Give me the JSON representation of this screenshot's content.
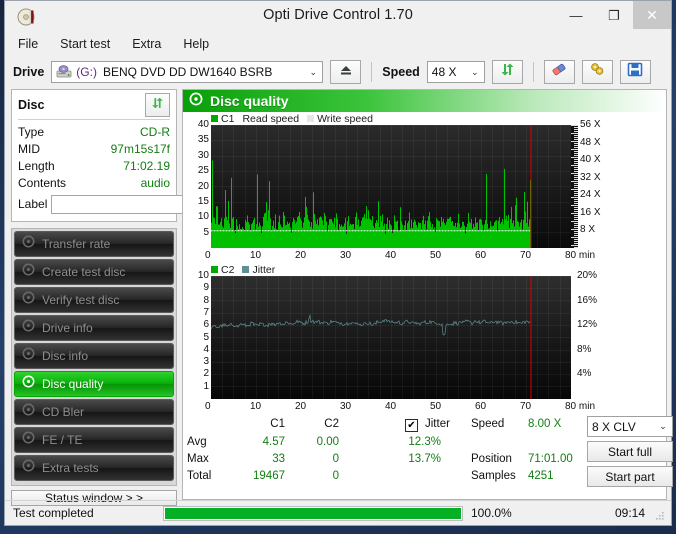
{
  "window": {
    "title": "Opti Drive Control 1.70",
    "icon": "disc-icon",
    "minimize": "—",
    "maximize": "❐",
    "close": "✕"
  },
  "menu": {
    "items": [
      "File",
      "Start test",
      "Extra",
      "Help"
    ]
  },
  "toolbar": {
    "drive_label": "Drive",
    "drive_letter": "(G:)",
    "drive_value": "BENQ DVD DD DW1640 BSRB",
    "speed_label": "Speed",
    "speed_value": "48 X",
    "refresh_icon": "refresh-arrows-icon",
    "eject_icon": "eject-icon",
    "erase_icon": "eraser-icon",
    "bitsetting_icon": "bitsetting-icon",
    "save_icon": "floppy-save-icon",
    "caret": "⌄"
  },
  "disc": {
    "header": "Disc",
    "refresh_icon": "refresh-arrows-icon",
    "rows": [
      {
        "key": "Type",
        "value": "CD-R"
      },
      {
        "key": "MID",
        "value": "97m15s17f"
      },
      {
        "key": "Length",
        "value": "71:02.19"
      },
      {
        "key": "Contents",
        "value": "audio"
      }
    ],
    "label_key": "Label",
    "label_value": "",
    "label_placeholder": "",
    "cd_icon": "cd-disc-icon"
  },
  "nav": {
    "items": [
      {
        "label": "Transfer rate",
        "icon": "disc-icon",
        "active": false
      },
      {
        "label": "Create test disc",
        "icon": "disc-icon",
        "active": false
      },
      {
        "label": "Verify test disc",
        "icon": "disc-icon",
        "active": false
      },
      {
        "label": "Drive info",
        "icon": "disc-icon",
        "active": false
      },
      {
        "label": "Disc info",
        "icon": "disc-icon",
        "active": false
      },
      {
        "label": "Disc quality",
        "icon": "disc-icon",
        "active": true
      },
      {
        "label": "CD Bler",
        "icon": "disc-icon",
        "active": false
      },
      {
        "label": "FE / TE",
        "icon": "disc-icon",
        "active": false
      },
      {
        "label": "Extra tests",
        "icon": "disc-icon",
        "active": false
      }
    ],
    "status_button": "Status window > >"
  },
  "panel": {
    "title": "Disc quality",
    "icon": "disc-icon"
  },
  "stats": {
    "col_c1": "C1",
    "col_c2": "C2",
    "rows": [
      {
        "label": "Avg",
        "c1": "4.57",
        "c2": "0.00",
        "jitter": "12.3%"
      },
      {
        "label": "Max",
        "c1": "33",
        "c2": "0",
        "jitter": "13.7%"
      },
      {
        "label": "Total",
        "c1": "19467",
        "c2": "0",
        "jitter": ""
      }
    ],
    "jitter_label": "Jitter",
    "jitter_checked": "✔",
    "speed_label": "Speed",
    "speed_value": "8.00 X",
    "position_label": "Position",
    "position_value": "71:01.00",
    "samples_label": "Samples",
    "samples_value": "4251",
    "write_strategy": "8 X CLV",
    "caret": "⌄",
    "start_full": "Start full",
    "start_part": "Start part"
  },
  "statusbar": {
    "message": "Test completed",
    "percent_text": "100.0%",
    "percent_value": 100,
    "time": "09:14",
    "grip_icon": "resize-grip-icon"
  },
  "colors": {
    "accent_green": "#00c000",
    "value_green": "#127d12",
    "jitter_teal": "#5f8f93",
    "plot_bg": "#121212",
    "marker_red": "#e00000",
    "avg_white": "#ffffff"
  },
  "chart_data": [
    {
      "type": "area",
      "name": "c1-chart",
      "title": "C1",
      "legend": [
        "C1",
        "Read speed",
        "Write speed"
      ],
      "legend_colors": [
        "#00a800",
        "#d8d8d8",
        "#e8e8e8"
      ],
      "xlabel": "min",
      "xlim": [
        0,
        80
      ],
      "xticks": [
        0,
        10,
        20,
        30,
        40,
        50,
        60,
        70,
        80
      ],
      "xtick_labels": [
        "0",
        "10",
        "20",
        "30",
        "40",
        "50",
        "60",
        "70",
        "80 min"
      ],
      "ylabel_left": "C1",
      "ylim": [
        0,
        40
      ],
      "yticks": [
        5,
        10,
        15,
        20,
        25,
        30,
        35,
        40
      ],
      "ylabel_right": "Speed",
      "ylim_right": [
        0,
        56
      ],
      "yticks_right": [
        8,
        16,
        24,
        32,
        40,
        48,
        56
      ],
      "ytick_labels_right": [
        "8 X",
        "16 X",
        "24 X",
        "32 X",
        "40 X",
        "48 X",
        "56 X"
      ],
      "data_end_min": 71.0,
      "marker_min": 71.0,
      "avg_line": 4.57,
      "avg_line_color": "#ffffff",
      "series": [
        {
          "name": "C1",
          "color": "#00c000",
          "x_start": 0,
          "x_end": 71.0,
          "values": [
            8,
            17,
            11,
            9,
            6,
            20,
            21,
            10,
            6,
            7,
            12,
            8,
            7,
            9,
            29,
            15,
            12,
            22,
            9,
            8,
            33,
            13,
            10,
            7,
            6,
            12,
            9,
            6,
            5,
            9,
            8,
            10,
            7,
            6,
            11,
            7,
            12,
            9,
            8,
            6,
            5,
            9,
            10,
            11,
            6,
            7,
            14,
            9,
            8,
            7,
            6,
            10,
            13,
            16,
            17,
            22,
            14,
            15,
            11,
            9,
            8,
            7,
            9,
            6,
            11,
            8,
            7,
            10,
            12,
            9,
            8,
            6,
            14,
            11,
            9,
            8,
            7,
            12,
            10,
            9,
            6,
            8,
            13,
            11,
            10,
            7,
            9,
            15,
            12,
            10,
            8,
            6,
            9,
            11,
            27,
            22,
            14,
            12,
            9,
            8,
            10,
            7,
            24,
            15,
            12,
            9,
            8,
            11,
            13,
            10,
            9,
            7,
            8,
            12,
            11,
            9,
            7,
            6,
            10,
            9,
            8,
            7,
            11,
            9,
            8,
            12,
            10,
            7,
            6,
            9,
            11,
            8,
            7,
            10,
            9,
            6,
            8,
            12,
            10,
            9,
            7,
            11,
            8,
            6,
            9,
            13,
            10,
            8,
            7,
            6,
            9,
            12,
            11,
            16,
            14,
            19,
            15,
            13,
            11,
            9,
            8,
            12,
            10,
            7,
            9,
            11,
            8,
            6,
            7,
            10,
            9,
            12,
            8,
            7,
            6,
            9,
            11,
            8,
            10,
            7,
            9,
            6,
            8,
            11,
            10,
            13,
            9,
            8,
            7,
            16,
            12,
            10,
            8,
            9,
            11,
            7,
            6,
            10,
            13,
            9,
            8,
            7,
            11,
            12,
            10,
            8,
            6,
            9,
            7,
            10,
            8,
            12,
            11,
            9,
            7,
            6,
            8,
            10,
            12,
            9,
            8,
            11,
            7,
            9,
            6,
            10,
            8,
            7,
            12,
            9,
            11,
            8,
            10,
            7,
            6,
            9,
            12,
            8,
            10,
            13,
            9,
            7,
            11,
            8,
            10,
            6,
            9,
            12,
            8,
            7,
            10,
            11,
            9,
            8,
            6,
            7,
            10,
            12,
            9,
            8,
            11,
            7,
            6,
            9,
            10,
            8,
            12,
            7,
            9,
            11,
            8,
            10,
            6,
            7,
            9,
            12,
            10,
            8,
            7,
            11,
            9,
            6,
            8,
            10,
            12,
            9,
            7,
            8,
            11,
            10,
            6,
            9,
            7,
            12,
            8,
            10,
            9,
            11,
            7
          ]
        }
      ]
    },
    {
      "type": "line",
      "name": "c2-jitter-chart",
      "title": "C2 / Jitter",
      "legend": [
        "C2",
        "Jitter"
      ],
      "legend_colors": [
        "#00a800",
        "#5f8f93"
      ],
      "xlabel": "min",
      "xlim": [
        0,
        80
      ],
      "xticks": [
        0,
        10,
        20,
        30,
        40,
        50,
        60,
        70,
        80
      ],
      "xtick_labels": [
        "0",
        "10",
        "20",
        "30",
        "40",
        "50",
        "60",
        "70",
        "80 min"
      ],
      "ylabel_left": "C2",
      "ylim": [
        0,
        10
      ],
      "yticks": [
        1,
        2,
        3,
        4,
        5,
        6,
        7,
        8,
        9,
        10
      ],
      "ylabel_right": "Jitter",
      "ylim_right": [
        0,
        20
      ],
      "yticks_right": [
        4,
        8,
        12,
        16,
        20
      ],
      "ytick_labels_right": [
        "4%",
        "8%",
        "12%",
        "16%",
        "20%"
      ],
      "data_end_min": 71.0,
      "marker_min": 71.0,
      "series": [
        {
          "name": "C2",
          "color": "#00a800",
          "values": []
        },
        {
          "name": "Jitter",
          "color": "#5f8f93",
          "unit": "%",
          "x_start": 0,
          "x_end": 71.0,
          "values": [
            11.6,
            11.8,
            11.7,
            11.9,
            12.0,
            11.8,
            11.9,
            12.1,
            12.0,
            11.8,
            12.2,
            12.0,
            11.9,
            12.1,
            12.3,
            12.0,
            11.9,
            12.2,
            12.1,
            12.0,
            12.3,
            12.2,
            12.1,
            12.4,
            12.3,
            12.2,
            12.5,
            12.3,
            12.2,
            12.4,
            12.6,
            12.4,
            12.3,
            12.5,
            13.4,
            12.7,
            12.5,
            12.6,
            12.4,
            12.5,
            12.3,
            12.4,
            12.6,
            12.5,
            12.3,
            12.4,
            12.2,
            12.3,
            12.5,
            12.4,
            12.2,
            12.3,
            12.1,
            12.2,
            12.4,
            12.3,
            12.1,
            12.2,
            12.5,
            12.6,
            12.8,
            12.7,
            12.5,
            12.6,
            12.4,
            12.5,
            12.3,
            12.4,
            12.6,
            12.5,
            12.3,
            12.4,
            12.2,
            12.3,
            12.5,
            12.4,
            12.6,
            12.5,
            12.3,
            12.4,
            12.2,
            10.5,
            12.1,
            12.3,
            12.2,
            12.4,
            12.3,
            12.5,
            12.4,
            12.6,
            12.5,
            12.3,
            12.7,
            12.5,
            12.4,
            12.6,
            12.5,
            12.3,
            12.4,
            12.6,
            12.5,
            12.4,
            12.3,
            12.5,
            12.4,
            12.6,
            12.5,
            12.4,
            12.3,
            12.5,
            12.6,
            12.4
          ]
        }
      ]
    }
  ]
}
